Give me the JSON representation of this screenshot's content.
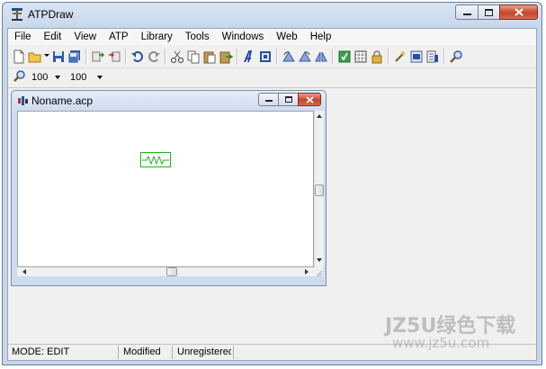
{
  "window": {
    "title": "ATPDraw"
  },
  "menu": [
    "File",
    "Edit",
    "View",
    "ATP",
    "Library",
    "Tools",
    "Windows",
    "Web",
    "Help"
  ],
  "toolbar": {
    "icons": [
      "new-file-icon",
      "open-folder-icon",
      "save-icon",
      "save-all-icon",
      "import-icon",
      "export-icon",
      "undo-icon",
      "redo-icon",
      "cut-icon",
      "copy-icon",
      "paste-icon",
      "paste-special-icon",
      "text-label-icon",
      "picture-icon",
      "rotate-left-icon",
      "rotate-right-icon",
      "flip-icon",
      "run-atp-icon",
      "grid-icon",
      "lock-icon",
      "settings-wand-icon",
      "view-icon",
      "list-icon",
      "find-icon"
    ]
  },
  "zoom": {
    "primary_value": "100",
    "secondary_value": "100"
  },
  "child_window": {
    "title": "Noname.acp"
  },
  "status": {
    "mode": "MODE: EDIT",
    "modified": "Modified",
    "registration": "Unregistered"
  },
  "watermark": {
    "brand": "JZ5U绿色下载",
    "url": "www.jz5u.com"
  },
  "colors": {
    "component_green": "#1bb51b",
    "close_red": "#c7432c"
  }
}
